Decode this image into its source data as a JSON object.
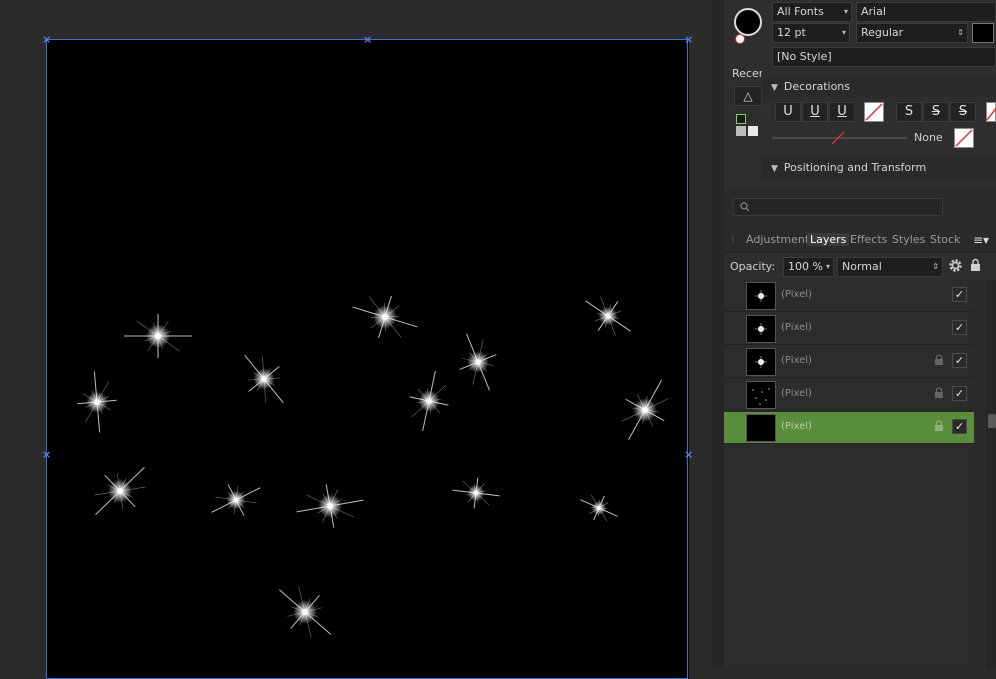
{
  "character": {
    "font_collection": "All Fonts",
    "font_family": "Arial",
    "font_size": "12 pt",
    "font_style": "Regular",
    "paragraph_style": "[No Style]",
    "recent_label": "Recen",
    "decorations_label": "Decorations",
    "decoration_buttons": [
      "U",
      "U",
      "U",
      "S",
      "S",
      "S"
    ],
    "line_style_value": "None",
    "positioning_label": "Positioning and Transform"
  },
  "layers_panel": {
    "tabs": [
      "Adjustment",
      "Layers",
      "Effects",
      "Styles",
      "Stock"
    ],
    "active_tab": "Layers",
    "opacity_label": "Opacity:",
    "opacity_value": "100 %",
    "blend_mode": "Normal",
    "layers": [
      {
        "name": "(Pixel)",
        "locked": false,
        "visible": true,
        "selected": false,
        "thumb": "star"
      },
      {
        "name": "(Pixel)",
        "locked": false,
        "visible": true,
        "selected": false,
        "thumb": "star"
      },
      {
        "name": "(Pixel)",
        "locked": true,
        "visible": true,
        "selected": false,
        "thumb": "star"
      },
      {
        "name": "(Pixel)",
        "locked": true,
        "visible": true,
        "selected": false,
        "thumb": "dots"
      },
      {
        "name": "(Pixel)",
        "locked": true,
        "visible": true,
        "selected": true,
        "thumb": "black"
      }
    ]
  },
  "colors": {
    "selection": "#3d6fd1",
    "selected_layer": "#5a8d3c",
    "canvas": "#000000"
  }
}
